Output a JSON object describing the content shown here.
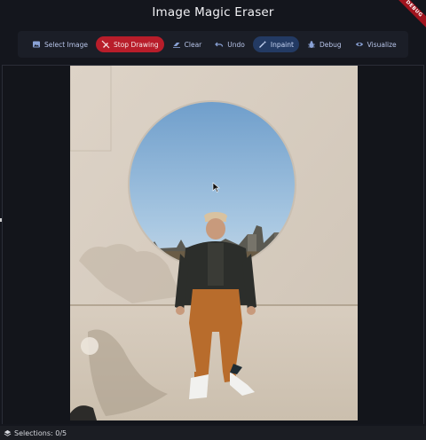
{
  "app": {
    "title": "Image Magic Eraser",
    "ribbon": "DEBUG"
  },
  "toolbar": {
    "select_image": "Select Image",
    "stop_drawing": "Stop Drawing",
    "clear": "Clear",
    "undo": "Undo",
    "inpaint": "Inpaint",
    "debug": "Debug",
    "visualize": "Visualize"
  },
  "status": {
    "selections": "Selections: 0/5"
  },
  "colors": {
    "accent_red": "#b81d2a",
    "accent_blue": "#233a63",
    "background": "#14161d",
    "toolbar_text": "#b7c4e8"
  },
  "icons": [
    "image-icon",
    "pen-off-icon",
    "eraser-icon",
    "undo-icon",
    "magic-wand-icon",
    "bug-icon",
    "eye-icon",
    "layers-icon"
  ]
}
